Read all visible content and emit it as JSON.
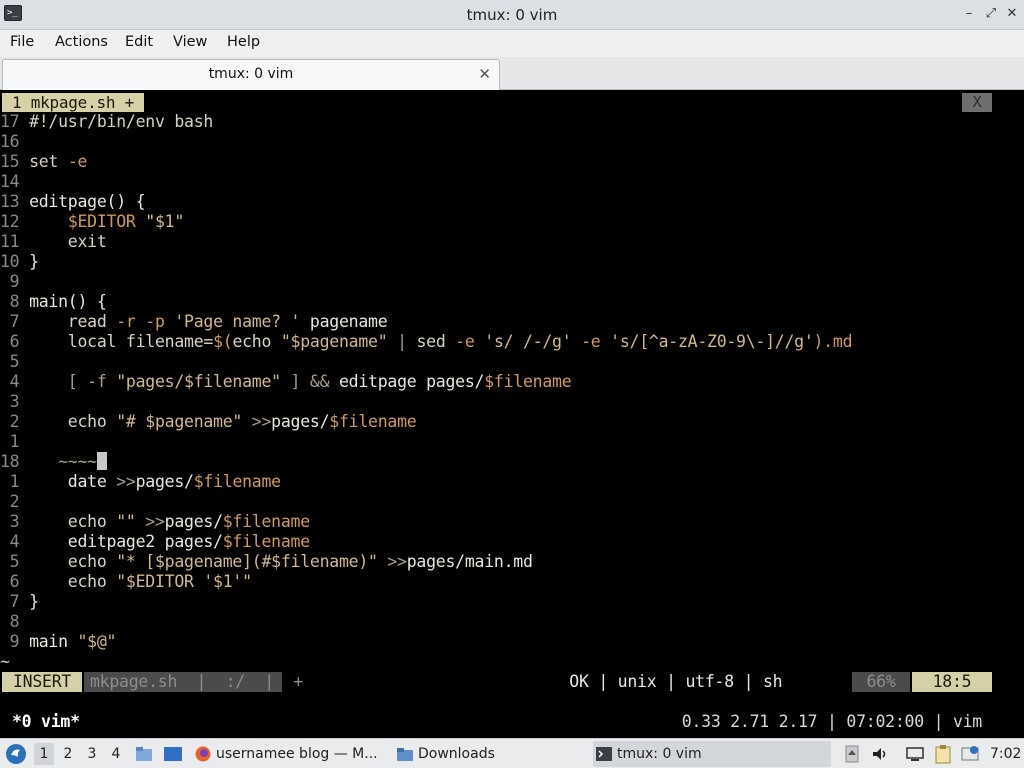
{
  "window": {
    "title": "tmux: 0 vim",
    "controls": {
      "minimize": "–",
      "maximize": "⤢",
      "close": "✕"
    }
  },
  "menubar": {
    "items": [
      "File",
      "Actions",
      "Edit",
      "View",
      "Help"
    ]
  },
  "tabs": [
    {
      "label": "tmux: 0 vim",
      "close": "✕"
    }
  ],
  "vim": {
    "buffer_tab": "1 mkpage.sh  +",
    "close_label": "X",
    "lines": [
      [
        {
          "t": "17 ",
          "c": "lnum"
        },
        {
          "t": "#!/usr/bin/env bash",
          "c": "txt"
        }
      ],
      [
        {
          "t": "16 ",
          "c": "lnum"
        }
      ],
      [
        {
          "t": "15 ",
          "c": "lnum"
        },
        {
          "t": "set ",
          "c": "txt"
        },
        {
          "t": "-e",
          "c": "var"
        }
      ],
      [
        {
          "t": "14 ",
          "c": "lnum"
        }
      ],
      [
        {
          "t": "13 ",
          "c": "lnum"
        },
        {
          "t": "editpage() {",
          "c": "fn"
        }
      ],
      [
        {
          "t": "12 ",
          "c": "lnum"
        },
        {
          "t": "    ",
          "c": "txt"
        },
        {
          "t": "$EDITOR ",
          "c": "var"
        },
        {
          "t": "\"$1\"",
          "c": "str"
        }
      ],
      [
        {
          "t": "11 ",
          "c": "lnum"
        },
        {
          "t": "    exit",
          "c": "txt"
        }
      ],
      [
        {
          "t": "10 ",
          "c": "lnum"
        },
        {
          "t": "}",
          "c": "fn"
        }
      ],
      [
        {
          "t": " 9 ",
          "c": "lnum"
        }
      ],
      [
        {
          "t": " 8 ",
          "c": "lnum"
        },
        {
          "t": "main() {",
          "c": "fn"
        }
      ],
      [
        {
          "t": " 7 ",
          "c": "lnum"
        },
        {
          "t": "    read ",
          "c": "txt"
        },
        {
          "t": "-r -p ",
          "c": "var"
        },
        {
          "t": "'Page name? '",
          "c": "str"
        },
        {
          "t": " pagename",
          "c": "fn"
        }
      ],
      [
        {
          "t": " 6 ",
          "c": "lnum"
        },
        {
          "t": "    local filename=",
          "c": "txt"
        },
        {
          "t": "$(",
          "c": "var"
        },
        {
          "t": "echo ",
          "c": "txt"
        },
        {
          "t": "\"$pagename\"",
          "c": "str"
        },
        {
          "t": " | ",
          "c": "op"
        },
        {
          "t": "sed ",
          "c": "txt"
        },
        {
          "t": "-e ",
          "c": "var"
        },
        {
          "t": "'s/ /-/g' ",
          "c": "str"
        },
        {
          "t": "-e ",
          "c": "var"
        },
        {
          "t": "'s/[^a-zA-Z0-9\\-]//g'",
          "c": "str"
        },
        {
          "t": ").md",
          "c": "var"
        }
      ],
      [
        {
          "t": " 5 ",
          "c": "lnum"
        }
      ],
      [
        {
          "t": " 4 ",
          "c": "lnum"
        },
        {
          "t": "    [ -f ",
          "c": "op"
        },
        {
          "t": "\"pages/$filename\"",
          "c": "str"
        },
        {
          "t": " ] && ",
          "c": "op"
        },
        {
          "t": "editpage pages/",
          "c": "fn"
        },
        {
          "t": "$filename",
          "c": "var"
        }
      ],
      [
        {
          "t": " 3 ",
          "c": "lnum"
        }
      ],
      [
        {
          "t": " 2 ",
          "c": "lnum"
        },
        {
          "t": "    echo ",
          "c": "txt"
        },
        {
          "t": "\"# $pagename\"",
          "c": "str"
        },
        {
          "t": " >>",
          "c": "op"
        },
        {
          "t": "pages/",
          "c": "fn"
        },
        {
          "t": "$filename",
          "c": "var"
        }
      ],
      [
        {
          "t": " 1 ",
          "c": "lnum"
        }
      ],
      [
        {
          "t": "18 ",
          "c": "lnum"
        },
        {
          "t": "   ~~~~",
          "c": "op"
        },
        {
          "t": "",
          "c": "cursor"
        }
      ],
      [
        {
          "t": " 1 ",
          "c": "lnum"
        },
        {
          "t": "    date ",
          "c": "fn"
        },
        {
          "t": ">>",
          "c": "op"
        },
        {
          "t": "pages/",
          "c": "fn"
        },
        {
          "t": "$filename",
          "c": "var"
        }
      ],
      [
        {
          "t": " 2 ",
          "c": "lnum"
        }
      ],
      [
        {
          "t": " 3 ",
          "c": "lnum"
        },
        {
          "t": "    echo ",
          "c": "txt"
        },
        {
          "t": "\"\"",
          "c": "str"
        },
        {
          "t": " >>",
          "c": "op"
        },
        {
          "t": "pages/",
          "c": "fn"
        },
        {
          "t": "$filename",
          "c": "var"
        }
      ],
      [
        {
          "t": " 4 ",
          "c": "lnum"
        },
        {
          "t": "    editpage2 pages/",
          "c": "fn"
        },
        {
          "t": "$filename",
          "c": "var"
        }
      ],
      [
        {
          "t": " 5 ",
          "c": "lnum"
        },
        {
          "t": "    echo ",
          "c": "txt"
        },
        {
          "t": "\"* [$pagename](#$filename)\"",
          "c": "str"
        },
        {
          "t": " >>",
          "c": "op"
        },
        {
          "t": "pages/main.md",
          "c": "fn"
        }
      ],
      [
        {
          "t": " 6 ",
          "c": "lnum"
        },
        {
          "t": "    echo ",
          "c": "txt"
        },
        {
          "t": "\"$EDITOR '$1'\"",
          "c": "str"
        }
      ],
      [
        {
          "t": " 7 ",
          "c": "lnum"
        },
        {
          "t": "}",
          "c": "fn"
        }
      ],
      [
        {
          "t": " 8 ",
          "c": "lnum"
        }
      ],
      [
        {
          "t": " 9 ",
          "c": "lnum"
        },
        {
          "t": "main ",
          "c": "fn"
        },
        {
          "t": "\"$@\"",
          "c": "str"
        }
      ],
      [
        {
          "t": "~",
          "c": "txt"
        }
      ]
    ],
    "statusline": {
      "mode": "INSERT",
      "file": "mkpage.sh  |  :/  |  +",
      "right": "OK | unix | utf-8 | sh ",
      "percent": "66%",
      "position": "18:5"
    }
  },
  "tmux": {
    "left": "*0 vim*",
    "right": "0.33 2.71 2.17 | 07:02:00 | vim"
  },
  "taskbar": {
    "workspaces": [
      "1",
      "2",
      "3",
      "4"
    ],
    "tasks": [
      {
        "label": "usernamee blog — M...",
        "icon": "firefox-icon"
      },
      {
        "label": "Downloads",
        "icon": "folder-icon"
      },
      {
        "label": "tmux: 0 vim",
        "icon": "terminal-icon"
      }
    ],
    "clock": "7:02"
  },
  "colors": {
    "background": "#000000",
    "string": "#d2b88c",
    "variable": "#cf9a5c",
    "linenumber": "#8a8a82",
    "statusline_accent": "#d6d0a6"
  }
}
